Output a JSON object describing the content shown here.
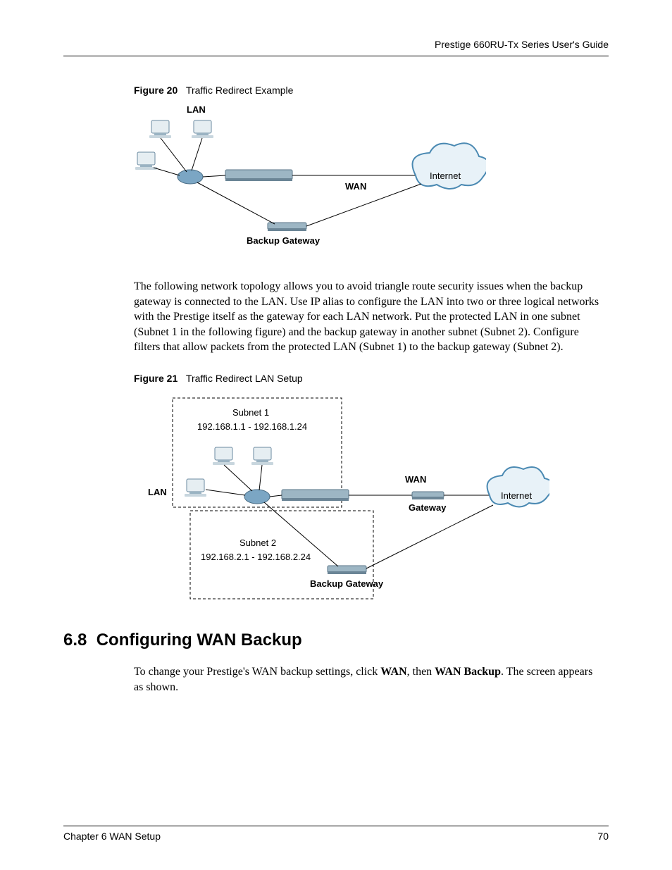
{
  "header": {
    "guide_title": "Prestige 660RU-Tx Series User's Guide"
  },
  "figure20": {
    "label": "Figure 20",
    "title": "Traffic Redirect Example",
    "labels": {
      "lan": "LAN",
      "wan": "WAN",
      "internet": "Internet",
      "backup_gateway": "Backup Gateway"
    }
  },
  "paragraph1": "The following network topology allows you to avoid triangle route security issues when the backup gateway is connected to the LAN. Use IP alias to configure the LAN into two or three logical networks with the Prestige itself as the gateway for each LAN network. Put the protected LAN in one subnet (Subnet 1 in the following figure) and the backup gateway in another subnet (Subnet 2). Configure filters that allow packets from the protected LAN (Subnet 1) to the backup gateway (Subnet 2).",
  "figure21": {
    "label": "Figure 21",
    "title": "Traffic Redirect LAN Setup",
    "labels": {
      "subnet1_title": "Subnet 1",
      "subnet1_range": "192.168.1.1 - 192.168.1.24",
      "subnet2_title": "Subnet 2",
      "subnet2_range": "192.168.2.1 - 192.168.2.24",
      "lan": "LAN",
      "wan": "WAN",
      "gateway": "Gateway",
      "backup_gateway": "Backup Gateway",
      "internet": "Internet"
    }
  },
  "section": {
    "number": "6.8",
    "title": "Configuring WAN Backup",
    "body_pre": "To change your Prestige's WAN backup settings, click ",
    "body_wan": "WAN",
    "body_mid": ", then ",
    "body_wanbackup": "WAN Backup",
    "body_post": ". The screen appears as shown."
  },
  "footer": {
    "chapter": "Chapter 6 WAN Setup",
    "page": "70"
  }
}
